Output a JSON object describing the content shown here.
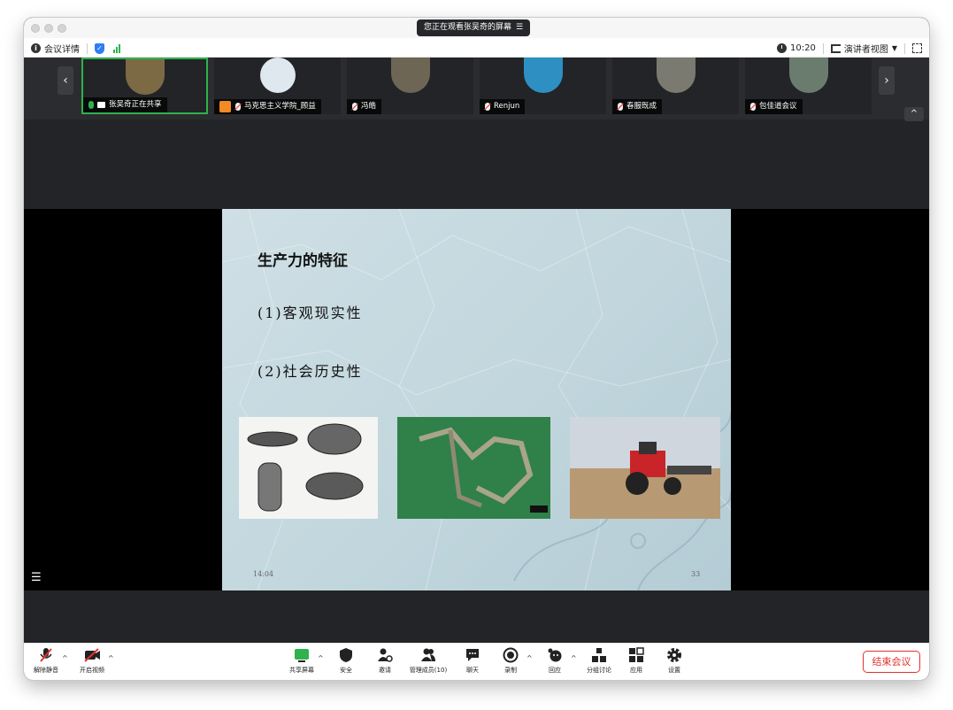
{
  "banner": {
    "text": "您正在观看张吴奇的屏幕",
    "menu_glyph": "☰"
  },
  "infobar": {
    "meeting_info": "会议详情",
    "time": "10:20",
    "view_mode": "演讲者视图"
  },
  "participants": [
    {
      "name": "张吴奇正在共享",
      "avatar_color": "#7c6a45"
    },
    {
      "name": "马克思主义学院_顾益",
      "avatar_color": "#dfe8ef"
    },
    {
      "name": "冯皓",
      "avatar_color": "#6d6654"
    },
    {
      "name": "Renjun",
      "avatar_color": "#2d8fc2"
    },
    {
      "name": "春服既成",
      "avatar_color": "#7b7a70"
    },
    {
      "name": "包佳道会议",
      "avatar_color": "#6a7c6e"
    }
  ],
  "slide": {
    "title": "生产力的特征",
    "points": [
      "(1)客观现实性",
      "(2)社会历史性"
    ],
    "time": "14:04",
    "page": "33"
  },
  "toolbar": {
    "unmute": "解除静音",
    "start_video": "开启视频",
    "share_screen": "共享屏幕",
    "security": "安全",
    "invite": "邀请",
    "participants": "管理成员(10)",
    "chat": "聊天",
    "record": "录制",
    "reactions": "回应",
    "breakout": "分组讨论",
    "apps": "应用",
    "settings": "设置",
    "end_meeting": "结束会议"
  },
  "colors": {
    "accent": "#2d7df6",
    "active_border": "#2fb14e",
    "end_red": "#e2322e"
  }
}
